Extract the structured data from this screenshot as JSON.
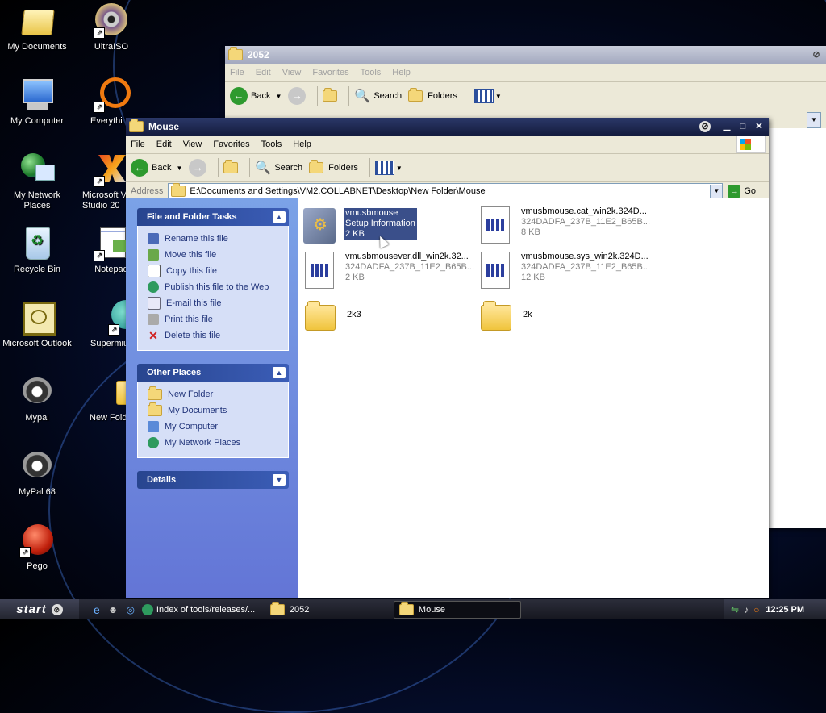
{
  "desktop": {
    "icons": [
      {
        "label": "My Documents"
      },
      {
        "label": "UltraISO"
      },
      {
        "label": "My Computer"
      },
      {
        "label": "Everythi"
      },
      {
        "label": "My Network Places"
      },
      {
        "label": "Microsoft V Studio 20"
      },
      {
        "label": "Recycle Bin"
      },
      {
        "label": "Notepad"
      },
      {
        "label": "Microsoft Outlook"
      },
      {
        "label": "Supermiu"
      },
      {
        "label": "Mypal"
      },
      {
        "label": "New Fold"
      },
      {
        "label": "MyPal 68"
      },
      {
        "label": "Pego"
      }
    ]
  },
  "back_window": {
    "title": "2052",
    "menu": [
      "File",
      "Edit",
      "View",
      "Favorites",
      "Tools",
      "Help"
    ],
    "toolbar": {
      "back": "Back",
      "search": "Search",
      "folders": "Folders"
    }
  },
  "window": {
    "title": "Mouse",
    "menu": [
      "File",
      "Edit",
      "View",
      "Favorites",
      "Tools",
      "Help"
    ],
    "toolbar": {
      "back": "Back",
      "search": "Search",
      "folders": "Folders"
    },
    "address": {
      "label": "Address",
      "value": "E:\\Documents and Settings\\VM2.COLLABNET\\Desktop\\New Folder\\Mouse",
      "go": "Go"
    },
    "tasks": {
      "title": "File and Folder Tasks",
      "items": [
        "Rename this file",
        "Move this file",
        "Copy this file",
        "Publish this file to the Web",
        "E-mail this file",
        "Print this file",
        "Delete this file"
      ]
    },
    "other_places": {
      "title": "Other Places",
      "items": [
        "New Folder",
        "My Documents",
        "My Computer",
        "My Network Places"
      ]
    },
    "details": {
      "title": "Details"
    },
    "files": [
      {
        "name": "vmusbmouse",
        "type": "Setup Information",
        "size": "2 KB"
      },
      {
        "name": "vmusbmouse.cat_win2k.324D...",
        "type": "324DADFA_237B_11E2_B65B...",
        "size": "8 KB"
      },
      {
        "name": "vmusbmousever.dll_win2k.32...",
        "type": "324DADFA_237B_11E2_B65B...",
        "size": "2 KB"
      },
      {
        "name": "vmusbmouse.sys_win2k.324D...",
        "type": "324DADFA_237B_11E2_B65B...",
        "size": "12 KB"
      },
      {
        "name": "2k3"
      },
      {
        "name": "2k"
      }
    ]
  },
  "taskbar": {
    "start": "start",
    "tasks": [
      "Index of tools/releases/...",
      "2052",
      "Mouse"
    ],
    "time": "12:25 PM"
  },
  "colors": {
    "title_active": "#1b2757",
    "title_inactive": "#9aa0b5",
    "selection": "#3a4f8a",
    "taskpane_blue": "#6d8ddc"
  }
}
